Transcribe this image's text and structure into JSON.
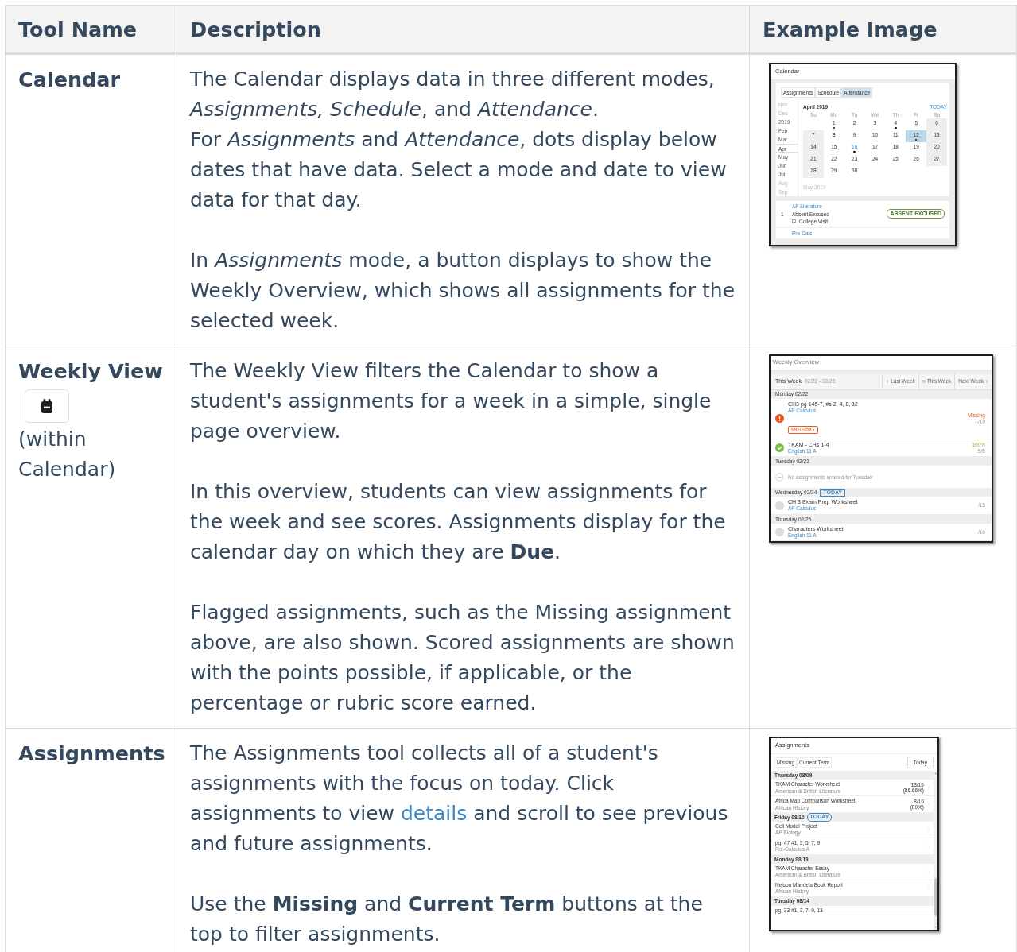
{
  "table": {
    "columns": [
      "Tool Name",
      "Description",
      "Example Image"
    ],
    "rows": [
      {
        "tool": {
          "name": "Calendar",
          "icon_button": false
        },
        "description": [
          [
            [
              {
                "kind": "text",
                "text": "The Calendar displays data in three different modes, *Assignments, Schedule*, and *Attendance*."
              }
            ],
            [
              {
                "kind": "text",
                "text": "For *Assignments* and *Attendance*, dots display below dates that have data. Select a mode and date to view data for that day."
              }
            ]
          ],
          [
            [
              {
                "kind": "text",
                "text": "In *Assignments* mode, a button displays to show the Weekly Overview, which shows all assignments for the selected week."
              }
            ]
          ]
        ],
        "example": {
          "kind": "calendar",
          "title": "Calendar",
          "tabs": [
            {
              "label": "Assignments",
              "selected": false
            },
            {
              "label": "Schedule",
              "selected": false
            },
            {
              "label": "Attendance",
              "selected": true
            }
          ],
          "months": [
            {
              "label": "Nov",
              "muted": true,
              "selected": false
            },
            {
              "label": "Dec",
              "muted": true,
              "selected": false
            },
            {
              "label": "2019",
              "muted": false,
              "selected": false
            },
            {
              "label": "Feb",
              "muted": false,
              "selected": false
            },
            {
              "label": "Mar",
              "muted": false,
              "selected": false
            },
            {
              "label": "Apr",
              "muted": false,
              "selected": true
            },
            {
              "label": "May",
              "muted": false,
              "selected": false
            },
            {
              "label": "Jun",
              "muted": false,
              "selected": false
            },
            {
              "label": "Jul",
              "muted": false,
              "selected": false
            },
            {
              "label": "Aug",
              "muted": true,
              "selected": false
            },
            {
              "label": "Sep",
              "muted": true,
              "selected": false
            }
          ],
          "heading": "April 2019",
          "today_label": "TODAY",
          "weekdays": [
            "Su",
            "Mo",
            "Tu",
            "We",
            "Th",
            "Fr",
            "Sa"
          ],
          "weeks": [
            [
              {
                "kind": "blank"
              },
              {
                "day": "1",
                "dot": true,
                "selected": false,
                "today": false
              },
              {
                "day": "2",
                "dot": false,
                "selected": false,
                "today": false
              },
              {
                "day": "3",
                "dot": false,
                "selected": false,
                "today": false
              },
              {
                "day": "4",
                "dot": true,
                "selected": false,
                "today": false
              },
              {
                "day": "5",
                "dot": false,
                "selected": false,
                "today": false
              },
              {
                "day": "6",
                "dot": false,
                "selected": false,
                "today": false
              }
            ],
            [
              {
                "day": "7",
                "dot": false,
                "selected": false,
                "today": false
              },
              {
                "day": "8",
                "dot": false,
                "selected": false,
                "today": false
              },
              {
                "day": "9",
                "dot": false,
                "selected": false,
                "today": false
              },
              {
                "day": "10",
                "dot": false,
                "selected": false,
                "today": false
              },
              {
                "day": "11",
                "dot": false,
                "selected": false,
                "today": false
              },
              {
                "day": "12",
                "dot": true,
                "selected": true,
                "today": false
              },
              {
                "day": "13",
                "dot": false,
                "selected": false,
                "today": false
              }
            ],
            [
              {
                "day": "14",
                "dot": false,
                "selected": false,
                "today": false
              },
              {
                "day": "15",
                "dot": false,
                "selected": false,
                "today": false
              },
              {
                "day": "16",
                "dot": true,
                "selected": false,
                "today": true
              },
              {
                "day": "17",
                "dot": false,
                "selected": false,
                "today": false
              },
              {
                "day": "18",
                "dot": false,
                "selected": false,
                "today": false
              },
              {
                "day": "19",
                "dot": false,
                "selected": false,
                "today": false
              },
              {
                "day": "20",
                "dot": false,
                "selected": false,
                "today": false
              }
            ],
            [
              {
                "day": "21",
                "dot": false,
                "selected": false,
                "today": false
              },
              {
                "day": "22",
                "dot": false,
                "selected": false,
                "today": false
              },
              {
                "day": "23",
                "dot": false,
                "selected": false,
                "today": false
              },
              {
                "day": "24",
                "dot": false,
                "selected": false,
                "today": false
              },
              {
                "day": "25",
                "dot": false,
                "selected": false,
                "today": false
              },
              {
                "day": "26",
                "dot": false,
                "selected": false,
                "today": false
              },
              {
                "day": "27",
                "dot": false,
                "selected": false,
                "today": false
              }
            ],
            [
              {
                "day": "28",
                "dot": false,
                "selected": false,
                "today": false
              },
              {
                "day": "29",
                "dot": false,
                "selected": false,
                "today": false
              },
              {
                "day": "30",
                "dot": false,
                "selected": false,
                "today": false
              },
              {
                "kind": "blank"
              },
              {
                "kind": "blank"
              },
              {
                "kind": "blank"
              },
              {
                "kind": "blank"
              }
            ]
          ],
          "next_heading": "May 2019",
          "entries": [
            {
              "period": "1",
              "course": "AP Literature",
              "status": "Absent Excused",
              "badge": "ABSENT EXCUSED",
              "comment": "College Visit"
            },
            {
              "course": "Pre-Calc"
            }
          ]
        }
      },
      {
        "tool": {
          "name": "Weekly View",
          "icon_button": true,
          "note": "(within Calendar)"
        },
        "description": [
          [
            [
              {
                "kind": "text",
                "text": "The Weekly View filters the Calendar to show a student's assignments for a week in a simple, single page overview."
              }
            ]
          ],
          [
            [
              {
                "kind": "text",
                "text": "In this overview, students can view assignments for the week and see scores. Assignments display for the calendar day on which they are **Due**."
              }
            ]
          ],
          [
            [
              {
                "kind": "text",
                "text": "Flagged assignments, such as the Missing assignment above, are also shown. Scored assignments are shown with the points possible, if applicable, or the percentage or rubric score earned."
              }
            ]
          ]
        ],
        "example": {
          "kind": "weekly",
          "title": "Weekly Overview",
          "week_label": "This Week",
          "range": "02/22 - 02/26",
          "nav": [
            {
              "kind": "prev",
              "label": "Last Week"
            },
            {
              "kind": "current",
              "label": "This Week"
            },
            {
              "kind": "next",
              "label": "Next Week"
            }
          ],
          "days": [
            {
              "label": "Monday 02/22",
              "items": [
                {
                  "kind": "missing",
                  "title": "CH3 pg 145-7, #s 2, 4, 8, 12",
                  "course": "AP Calculus",
                  "flag": "MISSING",
                  "score_label": "Missing",
                  "score": "--/10"
                },
                {
                  "kind": "graded",
                  "title": "TKAM - CHs 1-4",
                  "course": "English 11 A",
                  "score_label": "100%",
                  "score": "5/5"
                }
              ]
            },
            {
              "label": "Tuesday 02/23",
              "items": [
                {
                  "kind": "empty",
                  "text": "No assignments entered for Tuesday"
                }
              ]
            },
            {
              "label": "Wednesday 02/24",
              "badge": "TODAY",
              "items": [
                {
                  "kind": "ungraded",
                  "title": "CH 3 Exam Prep Worksheet",
                  "course": "AP Calculus",
                  "score": "/15"
                }
              ]
            },
            {
              "label": "Thursday 02/25",
              "items": [
                {
                  "kind": "ungraded",
                  "title": "Characters Worksheet",
                  "course": "English 11 A",
                  "score": "/10"
                }
              ]
            }
          ]
        }
      },
      {
        "tool": {
          "name": "Assignments",
          "icon_button": false
        },
        "description": [
          [
            [
              {
                "kind": "text",
                "text": "The Assignments tool collects all of a student's assignments with the focus on today. Click assignments to view "
              },
              {
                "kind": "link",
                "text": "details"
              },
              {
                "kind": "text",
                "text": " and scroll to see previous and future assignments."
              }
            ]
          ],
          [
            [
              {
                "kind": "text",
                "text": "Use the **Missing** and **Current Term** buttons at the top to filter assignments."
              }
            ]
          ]
        ],
        "example": {
          "kind": "assignments",
          "title": "Assignments",
          "filters": [
            "Missing",
            "Current Term"
          ],
          "today_button": "Today",
          "groups": [
            {
              "label": "Thursday 08/09",
              "items": [
                {
                  "title": "TKAM Character Worksheet",
                  "course": "American & British Literature",
                  "score": "13/15",
                  "percent": "(86.66%)"
                },
                {
                  "title": "Africa Map Comparison Worksheet",
                  "course": "African History",
                  "score": "8/10",
                  "percent": "(80%)"
                }
              ]
            },
            {
              "label": "Friday 08/10",
              "badge": "TODAY",
              "items": [
                {
                  "title": "Cell Model Project",
                  "course": "AP Biology"
                },
                {
                  "title": "pg. 47 #1, 3, 5, 7, 9",
                  "course": "Pre-Calculus A"
                }
              ]
            },
            {
              "label": "Monday 08/13",
              "items": [
                {
                  "title": "TKAM Character Essay",
                  "course": "American & British Literature"
                },
                {
                  "title": "Nelson Mandela Book Report",
                  "course": "African History"
                }
              ]
            },
            {
              "label": "Tuesday 08/14",
              "items": [
                {
                  "title": "pg. 33 #1, 3, 7, 9, 13"
                }
              ]
            }
          ]
        }
      }
    ]
  }
}
